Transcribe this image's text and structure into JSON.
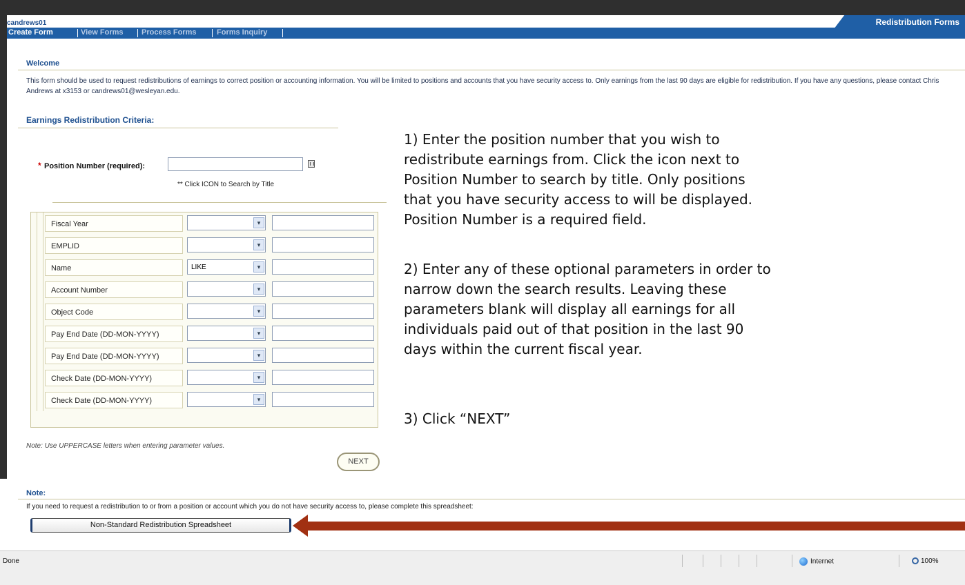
{
  "app": {
    "username": "candrews01",
    "title": "Redistribution Forms"
  },
  "nav": {
    "items": [
      "Create Form",
      "View Forms",
      "Process Forms",
      "Forms Inquiry"
    ]
  },
  "welcome": {
    "heading": "Welcome",
    "text": "This form should be used to request redistributions of earnings to correct position or accounting information. You will be limited to positions and accounts that you have security access to. Only earnings from the last 90 days are eligible for redistribution. If you have any questions, please contact Chris Andrews at x3153 or candrews01@wesleyan.edu."
  },
  "criteria": {
    "heading": "Earnings Redistribution Criteria:",
    "required_marker": "*",
    "position_label": "Position Number (required):",
    "position_value": "",
    "position_hint": "** Click ICON to Search by Title",
    "rows": [
      {
        "label": "Fiscal Year",
        "operator": ""
      },
      {
        "label": "EMPLID",
        "operator": ""
      },
      {
        "label": "Name",
        "operator": "LIKE"
      },
      {
        "label": "Account Number",
        "operator": ""
      },
      {
        "label": "Object Code",
        "operator": ""
      },
      {
        "label": "Pay End Date (DD-MON-YYYY)",
        "operator": ""
      },
      {
        "label": "Pay End Date (DD-MON-YYYY)",
        "operator": ""
      },
      {
        "label": "Check Date (DD-MON-YYYY)",
        "operator": ""
      },
      {
        "label": "Check Date (DD-MON-YYYY)",
        "operator": ""
      }
    ],
    "uppercase_note": "Note: Use UPPERCASE letters when entering parameter values.",
    "next_label": "NEXT"
  },
  "instructions": {
    "step1": "1) Enter the position number that you wish to\nredistribute earnings from. Click the icon next to\nPosition Number to search by title. Only positions\nthat you have security access to will be displayed.\nPosition Number is a required field.",
    "step2": "2) Enter any of these optional parameters in order to\nnarrow down the search results. Leaving these\nparameters blank will display all earnings for all\nindividuals paid out of that position in the last 90\ndays within the current fiscal year.",
    "step3": "3) Click “NEXT”"
  },
  "note": {
    "heading": "Note:",
    "text": "If you need to request a redistribution to or from a position or account which you do not have security access to, please complete this spreadsheet:",
    "button_label": "Non-Standard Redistribution Spreadsheet"
  },
  "status": {
    "left": "Done",
    "zone": "Internet",
    "zoom": "100%"
  },
  "colors": {
    "nav_bar": "#1f5fa6",
    "heading": "#1d4f8f",
    "arrow": "#a13012"
  }
}
